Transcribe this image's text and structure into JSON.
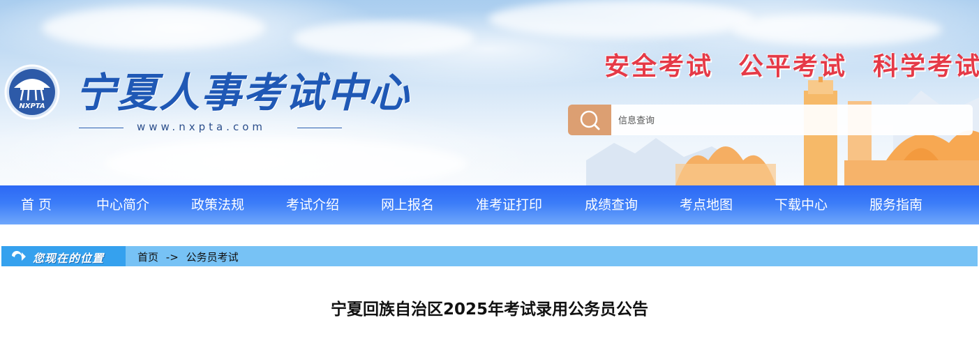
{
  "header": {
    "site_name": "宁夏人事考试中心",
    "site_url": "www.nxpta.com",
    "logo_text": "NXPTA",
    "slogans": [
      "安全考试",
      "公平考试",
      "科学考试"
    ],
    "search": {
      "placeholder": "信息查询",
      "value": ""
    }
  },
  "nav": {
    "items": [
      {
        "label": "首 页"
      },
      {
        "label": "中心简介"
      },
      {
        "label": "政策法规"
      },
      {
        "label": "考试介绍"
      },
      {
        "label": "网上报名"
      },
      {
        "label": "准考证打印"
      },
      {
        "label": "成绩查询"
      },
      {
        "label": "考点地图"
      },
      {
        "label": "下载中心"
      },
      {
        "label": "服务指南"
      }
    ]
  },
  "breadcrumb": {
    "tag": "您现在的位置",
    "home": "首页",
    "separator": "->",
    "current": "公务员考试"
  },
  "article": {
    "title": "宁夏回族自治区2025年考试录用公务员公告"
  },
  "colors": {
    "nav_blue": "#3b7cf8",
    "slogan_red": "#e53a47",
    "brand_blue": "#1f58b5",
    "search_accent": "#dc9f72",
    "breadcrumb_bg": "#77c2f5"
  },
  "icons": [
    "nxpta-logo-icon",
    "search-icon",
    "location-arrow-icon"
  ]
}
